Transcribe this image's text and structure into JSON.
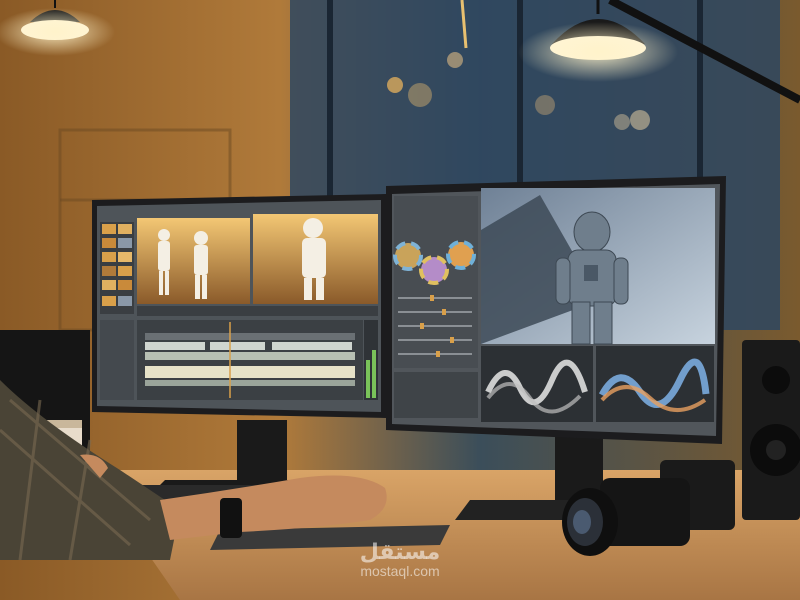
{
  "scene": {
    "description_tag": "photo",
    "colors": {
      "wall_warm": "#c08a3a",
      "window_blue": "#2f4a63",
      "desk_wood": "#c4935a",
      "monitor_frame": "#1c1c1e",
      "screen_ui_gray": "#5a5f64",
      "astronaut_sky": "#8fa3b5"
    }
  },
  "watermark": {
    "logo_text": "مستقل",
    "site": "mostaql.com"
  }
}
